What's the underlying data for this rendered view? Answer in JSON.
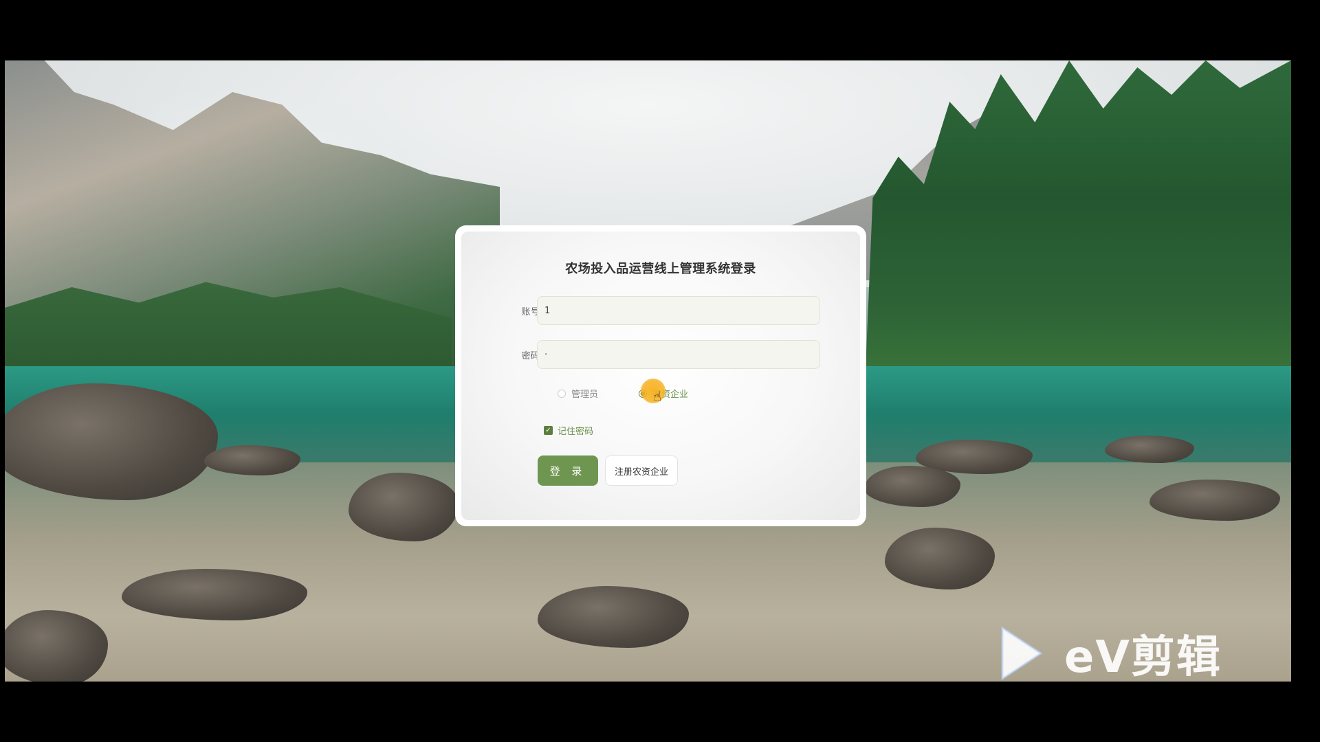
{
  "login": {
    "title": "农场投入品运营线上管理系统登录",
    "account_label": "账号:",
    "account_value": "1",
    "password_label": "密码:",
    "password_value": "·",
    "roles": [
      {
        "label": "管理员",
        "selected": false
      },
      {
        "label": "农资企业",
        "selected": true
      }
    ],
    "remember_label": "记住密码",
    "remember_checked": true,
    "login_button": "登 录",
    "register_button": "注册农资企业"
  },
  "watermark": {
    "text": "eV剪辑"
  },
  "colors": {
    "accent": "#6f9650",
    "click_marker": "#f7b01e"
  },
  "icons": {
    "cursor": "hand-pointer-icon",
    "watermark": "play-triangle-icon"
  }
}
